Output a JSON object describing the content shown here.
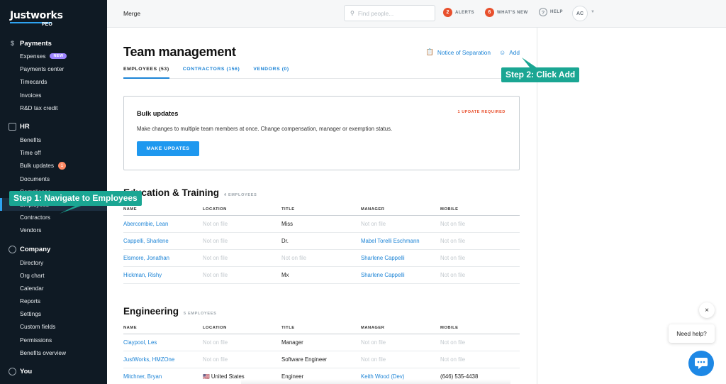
{
  "brand": {
    "name": "Justworks",
    "sub": "PEO"
  },
  "sidebar": {
    "sections": [
      {
        "title": "Payments",
        "icon": "dollar-icon",
        "items": [
          {
            "label": "Expenses",
            "badge": "NEW"
          },
          {
            "label": "Payments center"
          },
          {
            "label": "Timecards"
          },
          {
            "label": "Invoices"
          },
          {
            "label": "R&D tax credit"
          }
        ]
      },
      {
        "title": "HR",
        "icon": "hr-icon",
        "items": [
          {
            "label": "Benefits"
          },
          {
            "label": "Time off"
          },
          {
            "label": "Bulk updates",
            "count": "1"
          },
          {
            "label": "Documents"
          },
          {
            "label": "Compliance"
          },
          {
            "label": "Employees",
            "active": true
          },
          {
            "label": "Contractors"
          },
          {
            "label": "Vendors"
          }
        ]
      },
      {
        "title": "Company",
        "icon": "company-icon",
        "items": [
          {
            "label": "Directory"
          },
          {
            "label": "Org chart"
          },
          {
            "label": "Calendar"
          },
          {
            "label": "Reports"
          },
          {
            "label": "Settings"
          },
          {
            "label": "Custom fields"
          },
          {
            "label": "Permissions"
          },
          {
            "label": "Benefits overview"
          }
        ]
      },
      {
        "title": "You",
        "icon": "user-icon",
        "items": []
      }
    ]
  },
  "topbar": {
    "breadcrumb": "Merge",
    "search_placeholder": "Find people...",
    "alerts": {
      "count": "2",
      "label": "ALERTS"
    },
    "whats_new": {
      "count": "6",
      "label": "WHAT'S NEW"
    },
    "help": {
      "label": "HELP"
    },
    "avatar_initials": "AC"
  },
  "page": {
    "title": "Team management",
    "actions": {
      "notice": "Notice of Separation",
      "add": "Add"
    },
    "tabs": [
      {
        "label": "EMPLOYEES (53)",
        "active": true
      },
      {
        "label": "CONTRACTORS (156)"
      },
      {
        "label": "VENDORS (0)"
      }
    ],
    "bulk": {
      "title": "Bulk updates",
      "required": "1 UPDATE REQUIRED",
      "description": "Make changes to multiple team members at once. Change compensation, manager or exemption status.",
      "button": "MAKE UPDATES"
    },
    "columns": [
      "NAME",
      "LOCATION",
      "TITLE",
      "MANAGER",
      "MOBILE"
    ],
    "departments": [
      {
        "name": "Education & Training",
        "count": "4 EMPLOYEES",
        "rows": [
          {
            "name": "Abercombie, Lean",
            "location": "Not on file",
            "title": "Miss",
            "manager": "Not on file",
            "mobile": "Not on file"
          },
          {
            "name": "Cappelli, Sharlene",
            "location": "Not on file",
            "title": "Dr.",
            "manager": "Mabel Torelli Eschmann",
            "mobile": "Not on file"
          },
          {
            "name": "Elsmore, Jonathan",
            "location": "Not on file",
            "title": "Not on file",
            "manager": "Sharlene Cappelli",
            "mobile": "Not on file"
          },
          {
            "name": "Hickman, Rishy",
            "location": "Not on file",
            "title": "Mx",
            "manager": "Sharlene Cappelli",
            "mobile": "Not on file"
          }
        ]
      },
      {
        "name": "Engineering",
        "count": "5 EMPLOYEES",
        "rows": [
          {
            "name": "Claypool, Les",
            "location": "Not on file",
            "title": "Manager",
            "manager": "Not on file",
            "mobile": "Not on file"
          },
          {
            "name": "JustWorks, HMZOne",
            "location": "Not on file",
            "title": "Software Engineer",
            "manager": "Not on file",
            "mobile": "Not on file"
          },
          {
            "name": "Mitchner, Bryan",
            "location": "🇺🇸 United States",
            "title": "Engineer",
            "manager": "Keith Wood (Dev)",
            "mobile": "(646) 535-4438"
          }
        ]
      }
    ]
  },
  "tutorial": {
    "step1": "Step 1: Navigate to Employees",
    "step2": "Step 2: Click Add"
  },
  "help_widget": {
    "close": "×",
    "label": "Need help?"
  },
  "colors": {
    "sidebar": "#0f1a24",
    "accent": "#1e98ef",
    "link": "#1d84d6",
    "alert": "#e8502d",
    "callout": "#1aa693"
  }
}
